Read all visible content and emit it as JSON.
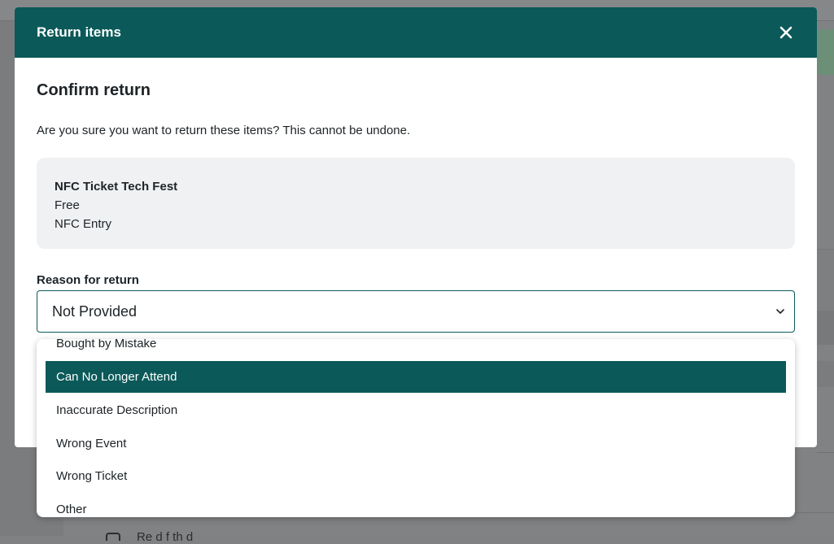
{
  "modal": {
    "title": "Return items",
    "close_icon": "close-icon",
    "confirm_heading": "Confirm return",
    "confirm_description": "Are you sure you want to return these items? This cannot be undone."
  },
  "item": {
    "name": "NFC Ticket Tech Fest",
    "price": "Free",
    "ticket_type": "NFC Entry"
  },
  "reason": {
    "label": "Reason for return",
    "selected_value": "Not Provided",
    "chevron_icon": "chevron-down-icon",
    "options": [
      {
        "label": "Bought by Mistake",
        "highlighted": false
      },
      {
        "label": "Can No Longer Attend",
        "highlighted": true
      },
      {
        "label": "Inaccurate Description",
        "highlighted": false
      },
      {
        "label": "Wrong Event",
        "highlighted": false
      },
      {
        "label": "Wrong Ticket",
        "highlighted": false
      },
      {
        "label": "Other",
        "highlighted": false
      }
    ]
  },
  "background": {
    "partial_text": "Re  d  f  th    d"
  },
  "colors": {
    "header_bg": "#0b5959",
    "highlight_bg": "#0b5959",
    "card_bg": "#f0f1f3"
  }
}
